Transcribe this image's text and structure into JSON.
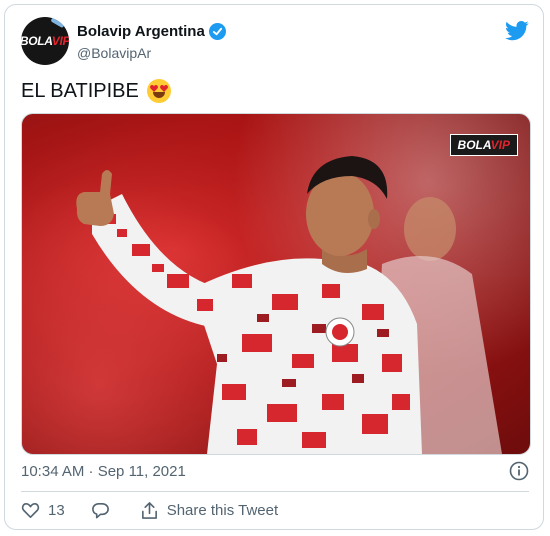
{
  "author": {
    "display_name": "Bolavip Argentina",
    "handle": "@BolavipAr",
    "avatar_text_main": "BOLA",
    "avatar_text_accent": "VIP"
  },
  "tweet": {
    "text": "EL BATIPIBE",
    "emoji": "heart-eyes-emoji",
    "media_watermark_main": "BOLA",
    "media_watermark_accent": "VIP",
    "timestamp": "10:34 AM · Sep 11, 2021"
  },
  "actions": {
    "like_count": "13",
    "share_label": "Share this Tweet"
  },
  "icons": {
    "verified": "verified-badge-icon",
    "brand": "twitter-bird-icon",
    "info": "info-icon",
    "like": "heart-icon",
    "reply": "reply-icon",
    "share": "share-icon"
  },
  "colors": {
    "twitter_blue": "#1d9bf0",
    "text_primary": "#0f1419",
    "text_secondary": "#536471",
    "border": "#cfd9de",
    "brand_red": "#e0242e"
  }
}
